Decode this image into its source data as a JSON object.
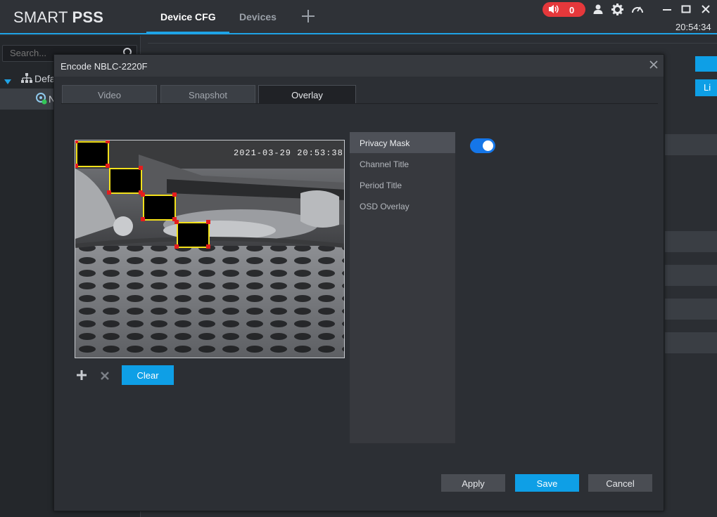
{
  "app": {
    "logo_light": "SMART ",
    "logo_bold": "PSS",
    "tabs": [
      {
        "label": "Device CFG"
      },
      {
        "label": "Devices"
      }
    ],
    "alarm_count": "0",
    "clock": "20:54:34"
  },
  "sidebar": {
    "search_placeholder": "Search...",
    "group_label": "Defa",
    "device_label": "N"
  },
  "background": {
    "button2_label": "Li"
  },
  "dialog": {
    "title": "Encode NBLC-2220F",
    "tabs": [
      {
        "label": "Video"
      },
      {
        "label": "Snapshot"
      },
      {
        "label": "Overlay"
      }
    ],
    "preview_timestamp": "2021-03-29 20:53:38",
    "clear_label": "Clear",
    "overlay_menu": [
      {
        "label": "Privacy Mask"
      },
      {
        "label": "Channel Title"
      },
      {
        "label": "Period Title"
      },
      {
        "label": "OSD Overlay"
      }
    ],
    "privacy_mask_enabled": true,
    "apply_label": "Apply",
    "save_label": "Save",
    "cancel_label": "Cancel"
  },
  "colors": {
    "accent": "#0e9fe6",
    "toggle": "#1576e8",
    "mask_border": "#f4e11b",
    "mask_handle": "#e51d1d",
    "alarm": "#e5383b"
  }
}
